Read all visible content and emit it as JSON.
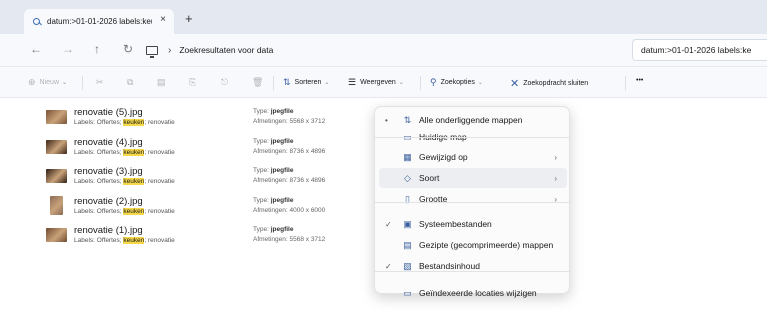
{
  "tab": {
    "title": "datum:>01-01-2026 labels:keu",
    "close": "×",
    "add": "+"
  },
  "nav": {
    "back": "←",
    "forward": "→",
    "up": "↑",
    "refresh": "↻"
  },
  "address": {
    "separator": "›",
    "path": "Zoekresultaten voor data"
  },
  "search": {
    "value": "datum:>01-01-2026 labels:ke"
  },
  "commands": {
    "new": "Nieuw",
    "sort": "Sorteren",
    "view": "Weergeven",
    "search_options": "Zoekopties",
    "close_search": "Zoekopdracht sluiten",
    "more": "•••"
  },
  "files": [
    {
      "name": "renovatie (5).jpg",
      "labels_prefix": "Labels: Offertes; ",
      "labels_hl": "keuken",
      "labels_suffix": "; renovatie",
      "type_label": "Type: ",
      "type": "jpegfile",
      "dims": "Afmetingen: 5568 x 3712",
      "color": "#7a5236"
    },
    {
      "name": "renovatie (4).jpg",
      "labels_prefix": "Labels: Offertes; ",
      "labels_hl": "keuken",
      "labels_suffix": "; renovatie",
      "type_label": "Type: ",
      "type": "jpegfile",
      "dims": "Afmetingen: 8736 x 4896",
      "color": "#3b2416"
    },
    {
      "name": "renovatie (3).jpg",
      "labels_prefix": "Labels: Offertes; ",
      "labels_hl": "keuken",
      "labels_suffix": "; renovatie",
      "type_label": "Type: ",
      "type": "jpegfile",
      "dims": "Afmetingen: 8736 x 4896",
      "color": "#2e1d12"
    },
    {
      "name": "renovatie (2).jpg",
      "labels_prefix": "Labels: Offertes; ",
      "labels_hl": "keuken",
      "labels_suffix": "; renovatie",
      "type_label": "Type: ",
      "type": "jpegfile",
      "dims": "Afmetingen: 4000 x 6000",
      "color": "#8a6a55"
    },
    {
      "name": "renovatie (1).jpg",
      "labels_prefix": "Labels: Offertes; ",
      "labels_hl": "keuken",
      "labels_suffix": "; renovatie",
      "type_label": "Type: ",
      "type": "jpegfile",
      "dims": "Afmetingen: 5568 x 3712",
      "color": "#6e4a2f"
    }
  ],
  "menu": {
    "items": [
      {
        "label": "Alle onderliggende mappen",
        "check": "•",
        "icon": "⇅",
        "arrow": ""
      },
      {
        "label": "Huidige map",
        "check": "",
        "icon": "▭",
        "arrow": ""
      },
      {
        "label": "Gewijzigd op",
        "check": "",
        "icon": "▦",
        "arrow": "›"
      },
      {
        "label": "Soort",
        "check": "",
        "icon": "◇",
        "arrow": "›"
      },
      {
        "label": "Grootte",
        "check": "",
        "icon": "▯",
        "arrow": "›"
      },
      {
        "label": "Systeembestanden",
        "check": "✓",
        "icon": "▣",
        "arrow": ""
      },
      {
        "label": "Gezipte (gecomprimeerde) mappen",
        "check": "",
        "icon": "▤",
        "arrow": ""
      },
      {
        "label": "Bestandsinhoud",
        "check": "✓",
        "icon": "▧",
        "arrow": ""
      },
      {
        "label": "Geïndexeerde locaties wijzigen",
        "check": "",
        "icon": "▭",
        "arrow": ""
      }
    ]
  }
}
